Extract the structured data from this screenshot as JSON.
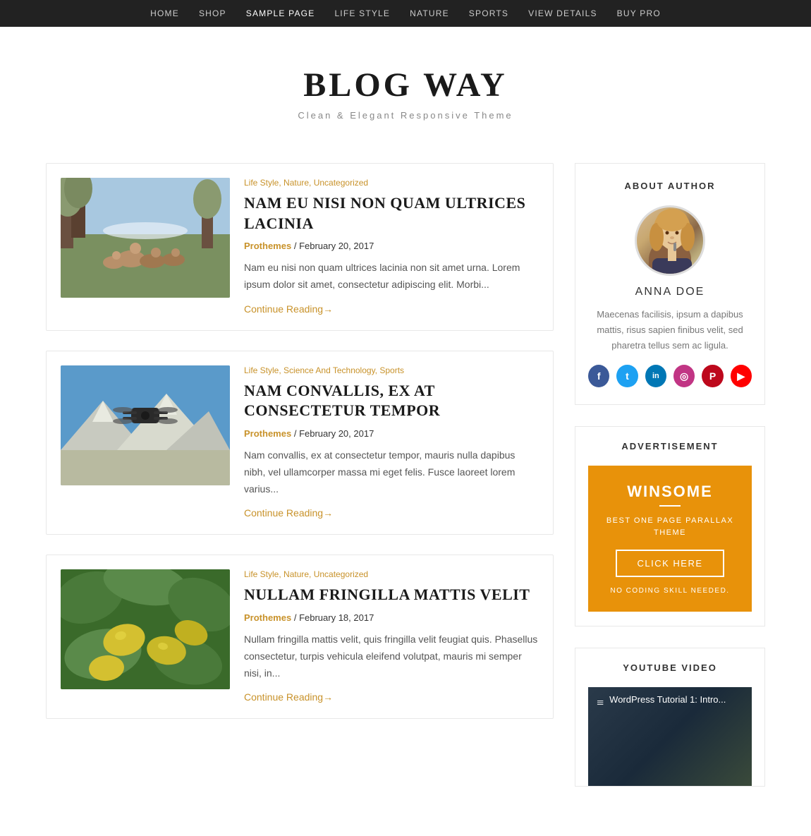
{
  "nav": {
    "items": [
      {
        "label": "HOME",
        "active": false
      },
      {
        "label": "SHOP",
        "active": false
      },
      {
        "label": "SAMPLE PAGE",
        "active": true
      },
      {
        "label": "LIFE STYLE",
        "active": false
      },
      {
        "label": "NATURE",
        "active": false
      },
      {
        "label": "SPORTS",
        "active": false
      },
      {
        "label": "VIEW DETAILS",
        "active": false
      },
      {
        "label": "BUY PRO",
        "active": false
      }
    ]
  },
  "header": {
    "title": "BLOG WAY",
    "tagline": "Clean & Elegant Responsive Theme"
  },
  "articles": [
    {
      "id": "article-1",
      "categories": "Life Style, Nature, Uncategorized",
      "title": "NAM EU NISI NON QUAM ULTRICES LACINIA",
      "author": "Prothemes",
      "date": "February 20, 2017",
      "excerpt": "Nam eu nisi non quam ultrices lacinia non sit amet urna. Lorem ipsum dolor sit amet, consectetur adipiscing elit. Morbi...",
      "read_more": "Continue Reading→",
      "thumb_type": "deer"
    },
    {
      "id": "article-2",
      "categories": "Life Style, Science And Technology, Sports",
      "title": "NAM CONVALLIS, EX AT CONSECTETUR TEMPOR",
      "author": "Prothemes",
      "date": "February 20, 2017",
      "excerpt": "Nam convallis, ex at consectetur tempor, mauris nulla dapibus nibh, vel ullamcorper massa mi eget felis. Fusce laoreet lorem varius...",
      "read_more": "Continue Reading→",
      "thumb_type": "drone"
    },
    {
      "id": "article-3",
      "categories": "Life Style, Nature, Uncategorized",
      "title": "NULLAM FRINGILLA MATTIS VELIT",
      "author": "Prothemes",
      "date": "February 18, 2017",
      "excerpt": "Nullam fringilla mattis velit, quis fringilla velit feugiat quis. Phasellus consectetur, turpis vehicula eleifend volutpat, mauris mi semper nisi, in...",
      "read_more": "Continue Reading→",
      "thumb_type": "lemon"
    }
  ],
  "sidebar": {
    "about_title": "ABOUT AUTHOR",
    "author_name": "ANNA DOE",
    "author_bio": "Maecenas facilisis, ipsum a dapibus mattis, risus sapien finibus velit, sed pharetra tellus sem ac ligula.",
    "social_icons": [
      "f",
      "t",
      "in",
      "ig",
      "p",
      "▶"
    ],
    "ad_title": "ADVERTISEMENT",
    "ad_brand": "WINSOME",
    "ad_desc": "BEST ONE PAGE PARALLAX THEME",
    "ad_btn": "CLICK HERE",
    "ad_no_code": "NO CODING SKILL NEEDED.",
    "yt_title": "YOUTUBE VIDEO",
    "yt_video_label": "WordPress Tutorial 1: Intro..."
  }
}
